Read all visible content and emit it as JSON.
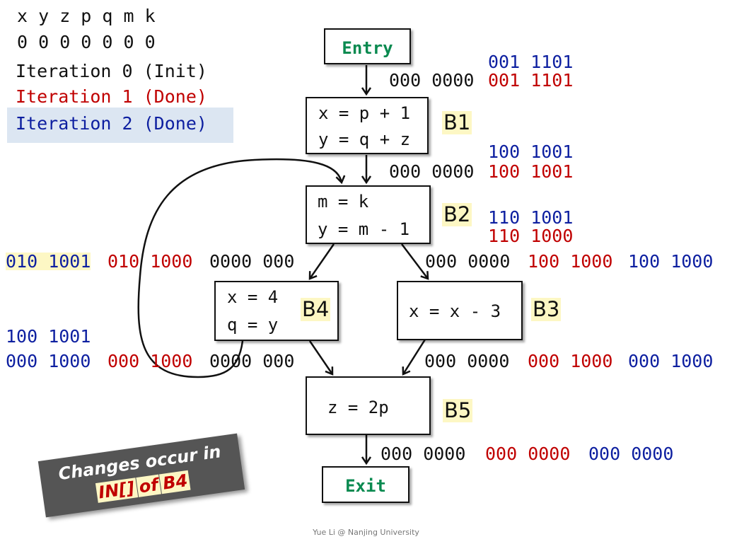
{
  "legend": {
    "variables": "x y z p q m k",
    "init_bits": "0 0 0 0 0 0 0",
    "iterations": [
      {
        "label": "Iteration 0 (Init)",
        "color": "#111111"
      },
      {
        "label": "Iteration 1 (Done)",
        "color": "#c00000"
      },
      {
        "label": "Iteration 2 (Done)",
        "color": "#0d1fa0",
        "highlighted": true
      }
    ]
  },
  "nodes": {
    "entry": {
      "label": "Entry"
    },
    "exit": {
      "label": "Exit"
    },
    "b1": {
      "name": "B1",
      "lines": [
        "x = p + 1",
        "y = q + z"
      ]
    },
    "b2": {
      "name": "B2",
      "lines": [
        "m = k",
        "y = m - 1"
      ]
    },
    "b3": {
      "name": "B3",
      "lines": [
        "x = x - 3"
      ]
    },
    "b4": {
      "name": "B4",
      "lines": [
        "x = 4",
        "q = y"
      ]
    },
    "b5": {
      "name": "B5",
      "lines": [
        "z = 2p"
      ]
    }
  },
  "bitvectors": {
    "b1_in": {
      "iter0": "000 0000",
      "iter1": "001 1101",
      "iter2": "001 1101"
    },
    "b1_out": {
      "iter0": "000 0000",
      "iter1": "100 1001",
      "iter2": "100 1001"
    },
    "b2_in": {
      "iter1": "110 1000",
      "iter2": "110 1001"
    },
    "b2_out_to_b3": {
      "iter0": "000 0000",
      "iter1": "100 1000",
      "iter2": "100 1000"
    },
    "b4_in": {
      "iter2": "010 1001",
      "iter1": "010 1000",
      "iter0": "0000 000"
    },
    "b4_out": {
      "iter2_alt": "100 1001",
      "iter2": "000 1000",
      "iter1": "000 1000",
      "iter0": "0000 000"
    },
    "b3_out": {
      "iter0": "000 0000",
      "iter1": "000 1000",
      "iter2": "000 1000"
    },
    "b5_out": {
      "iter0": "000 0000",
      "iter1": "000 0000",
      "iter2": "000 0000"
    }
  },
  "callout": {
    "line1": "Changes occur in",
    "line2_parts": [
      "IN[]",
      "of",
      "B4"
    ]
  },
  "footer": "Yue Li @ Nanjing University"
}
